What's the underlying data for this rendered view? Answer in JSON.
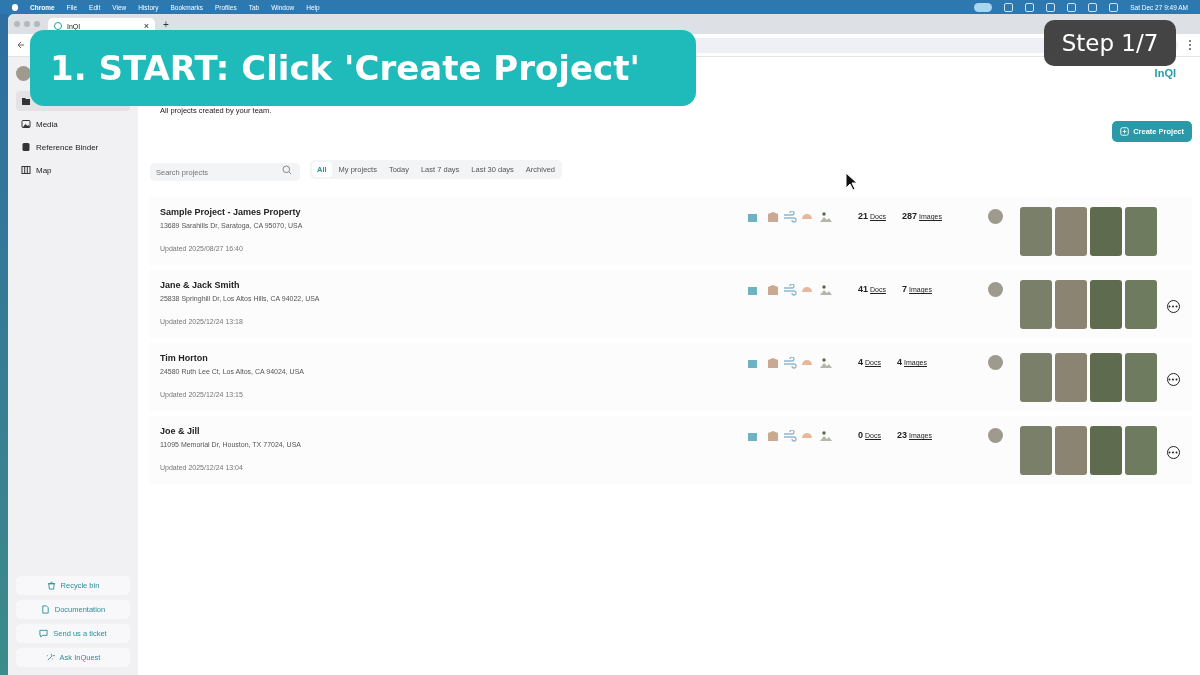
{
  "menubar": {
    "app": "Chrome",
    "menus": [
      "File",
      "Edit",
      "View",
      "History",
      "Bookmarks",
      "Profiles",
      "Tab",
      "Window",
      "Help"
    ],
    "clock": "Sat Dec 27  9:49 AM"
  },
  "browser": {
    "tab_title": "InQI",
    "tab_close": "×",
    "new_tab": "+"
  },
  "sidebar": {
    "items": [
      {
        "selected": true
      },
      {
        "label": "Media",
        "selected": false
      },
      {
        "label": "Reference Binder",
        "selected": false
      },
      {
        "label": "Map",
        "selected": false
      }
    ],
    "footer_buttons": [
      "Recycle bin",
      "Documentation",
      "Send us a ticket",
      "Ask InQuest"
    ]
  },
  "header": {
    "logo": "InQI",
    "subtitle": "All projects created by your team.",
    "create_button": "Create Project"
  },
  "search": {
    "placeholder": "Search projects"
  },
  "filters": [
    {
      "label": "All",
      "selected": true
    },
    {
      "label": "My projects",
      "selected": false
    },
    {
      "label": "Today",
      "selected": false
    },
    {
      "label": "Last 7 days",
      "selected": false
    },
    {
      "label": "Last 30 days",
      "selected": false
    },
    {
      "label": "Archived",
      "selected": false
    }
  ],
  "projects": [
    {
      "name": "Sample Project - James Property",
      "address": "13689 Sarahills Dr, Saratoga, CA 95070, USA",
      "updated": "Updated 2025/08/27 16:40",
      "docs": "21",
      "docs_label": "Docs",
      "images": "287",
      "images_label": "Images",
      "menu": false
    },
    {
      "name": "Jane & Jack Smith",
      "address": "25838 Springhill Dr, Los Altos Hills, CA 94022, USA",
      "updated": "Updated 2025/12/24 13:18",
      "docs": "41",
      "docs_label": "Docs",
      "images": "7",
      "images_label": "Images",
      "menu": true
    },
    {
      "name": "Tim Horton",
      "address": "24580 Ruth Lee Ct, Los Altos, CA 94024, USA",
      "updated": "Updated 2025/12/24 13:15",
      "docs": "4",
      "docs_label": "Docs",
      "images": "4",
      "images_label": "Images",
      "menu": true
    },
    {
      "name": "Joe & Jill",
      "address": "11095 Memorial Dr, Houston, TX 77024, USA",
      "updated": "Updated 2025/12/24 13:04",
      "docs": "0",
      "docs_label": "Docs",
      "images": "23",
      "images_label": "Images",
      "menu": true
    }
  ],
  "overlay": {
    "caption": "1. START: Click 'Create Project'",
    "step": "Step 1/7"
  }
}
